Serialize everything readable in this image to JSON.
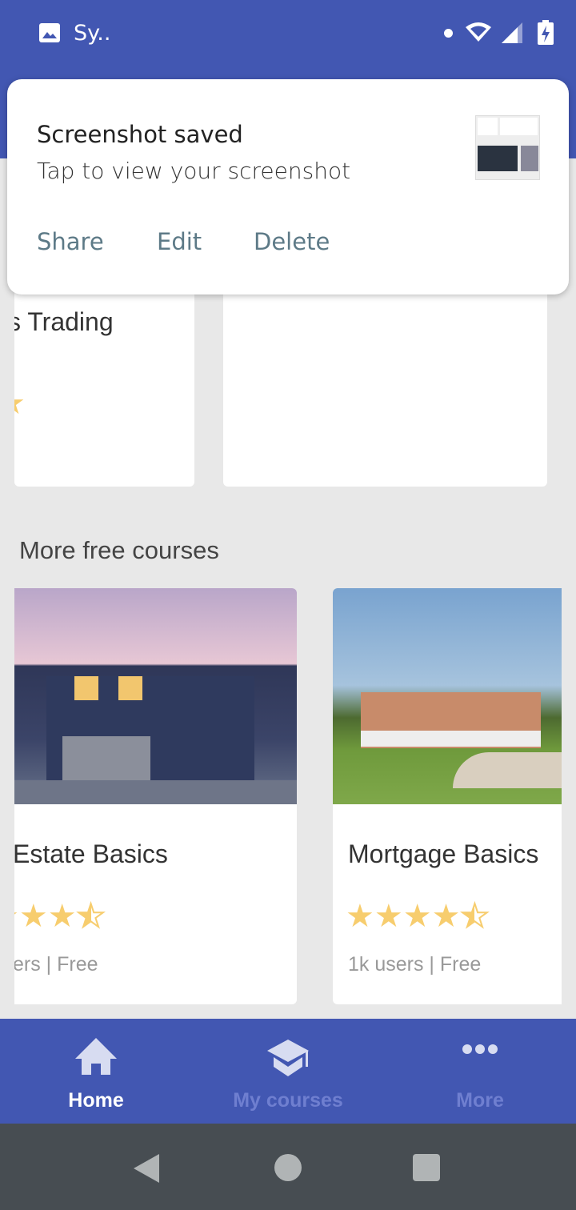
{
  "status_bar": {
    "app_label": "Sy..",
    "icons": [
      "image-icon",
      "dot-icon",
      "wifi-icon",
      "signal-icon",
      "battery-charging-icon"
    ]
  },
  "notification": {
    "title": "Screenshot saved",
    "body": "Tap to view your screenshot",
    "actions": [
      "Share",
      "Edit",
      "Delete"
    ]
  },
  "top_cards": [
    {
      "title": "s Trading"
    },
    {
      "title": ""
    }
  ],
  "section": {
    "title": "More free courses"
  },
  "courses": [
    {
      "title": "Estate Basics",
      "rating": 4.5,
      "meta": "ers | Free"
    },
    {
      "title": "Mortgage Basics",
      "rating": 4.5,
      "meta": "1k users | Free"
    }
  ],
  "bottom_nav": [
    {
      "label": "Home",
      "icon": "home-icon",
      "active": true
    },
    {
      "label": "My courses",
      "icon": "graduation-cap-icon",
      "active": false
    },
    {
      "label": "More",
      "icon": "more-dots-icon",
      "active": false
    }
  ],
  "colors": {
    "primary": "#4257b2",
    "star": "#f7cd6e",
    "action": "#5d7a87"
  }
}
